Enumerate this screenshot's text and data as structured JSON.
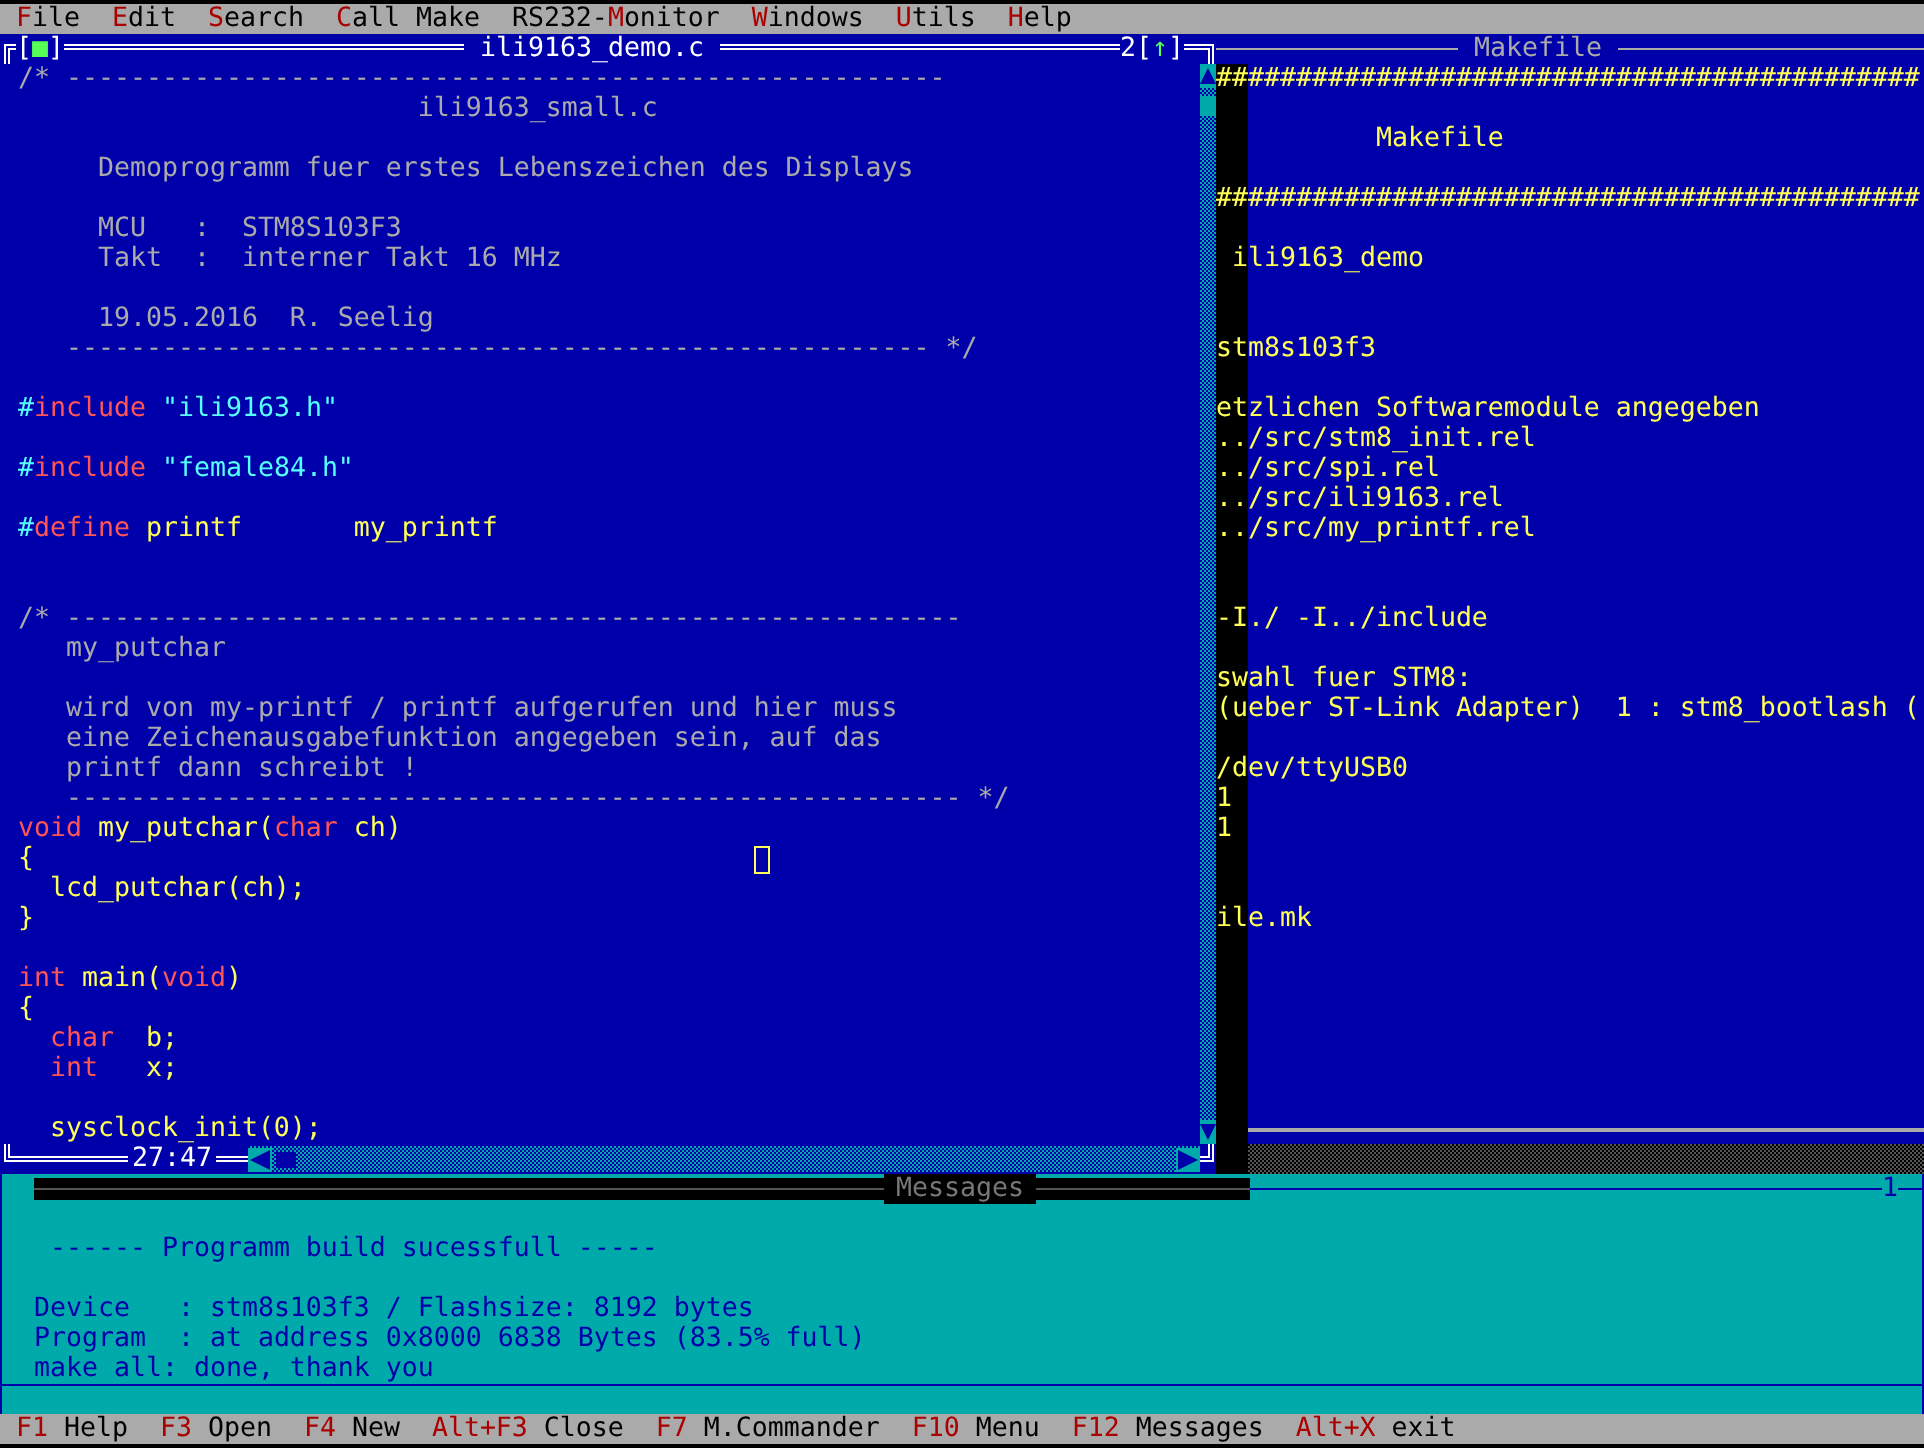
{
  "menu_bar": [
    {
      "key": "F",
      "rest": "ile"
    },
    {
      "key": "E",
      "rest": "dit"
    },
    {
      "key": "S",
      "rest": "earch"
    },
    {
      "key": "C",
      "rest": "all Make"
    },
    {
      "prefix": "RS232-",
      "key": "M",
      "rest": "onitor"
    },
    {
      "key": "W",
      "rest": "indows"
    },
    {
      "key": "U",
      "rest": "tils"
    },
    {
      "key": "H",
      "rest": "elp"
    }
  ],
  "editor": {
    "close_button": {
      "left": "[",
      "mark": "■",
      "right": "]"
    },
    "title": "ili9163_demo.c",
    "window_number": "2",
    "zoom_button": {
      "left": "[",
      "mark": "↑",
      "right": "]"
    },
    "position": "27:47",
    "lines": [
      {
        "kind": "code",
        "tokens": [
          {
            "text": "/* -------------------------------------------------------",
            "kind": "comment"
          }
        ]
      },
      {
        "kind": "code",
        "tokens": [
          {
            "text": "                         ili9163_small.c",
            "kind": "comment"
          }
        ]
      },
      {
        "kind": "blank"
      },
      {
        "kind": "code",
        "tokens": [
          {
            "text": "     Demoprogramm fuer erstes Lebenszeichen des Displays",
            "kind": "comment"
          }
        ]
      },
      {
        "kind": "blank"
      },
      {
        "kind": "code",
        "tokens": [
          {
            "text": "     MCU   :  STM8S103F3",
            "kind": "comment"
          }
        ]
      },
      {
        "kind": "code",
        "tokens": [
          {
            "text": "     Takt  :  interner Takt 16 MHz",
            "kind": "comment"
          }
        ]
      },
      {
        "kind": "blank"
      },
      {
        "kind": "code",
        "tokens": [
          {
            "text": "     19.05.2016  R. Seelig",
            "kind": "comment"
          }
        ]
      },
      {
        "kind": "code",
        "tokens": [
          {
            "text": "   ------------------------------------------------------ */",
            "kind": "comment"
          }
        ]
      },
      {
        "kind": "blank"
      },
      {
        "kind": "code",
        "tokens": [
          {
            "text": "#",
            "kind": "hash"
          },
          {
            "text": "include",
            "kind": "keyword"
          },
          {
            "text": " \"ili9163.h\"",
            "kind": "string"
          }
        ]
      },
      {
        "kind": "blank"
      },
      {
        "kind": "code",
        "tokens": [
          {
            "text": "#",
            "kind": "hash"
          },
          {
            "text": "include",
            "kind": "keyword"
          },
          {
            "text": " \"female84.h\"",
            "kind": "string"
          }
        ]
      },
      {
        "kind": "blank"
      },
      {
        "kind": "code",
        "tokens": [
          {
            "text": "#",
            "kind": "hash"
          },
          {
            "text": "define",
            "kind": "keyword"
          },
          {
            "text": " printf       my_printf",
            "kind": "plain"
          }
        ]
      },
      {
        "kind": "blank"
      },
      {
        "kind": "blank"
      },
      {
        "kind": "code",
        "tokens": [
          {
            "text": "/* --------------------------------------------------------",
            "kind": "comment"
          }
        ]
      },
      {
        "kind": "code",
        "tokens": [
          {
            "text": "   my_putchar",
            "kind": "comment"
          }
        ]
      },
      {
        "kind": "blank"
      },
      {
        "kind": "code",
        "tokens": [
          {
            "text": "   wird von my-printf / printf aufgerufen und hier muss",
            "kind": "comment"
          }
        ]
      },
      {
        "kind": "code",
        "tokens": [
          {
            "text": "   eine Zeichenausgabefunktion angegeben sein, auf das",
            "kind": "comment"
          }
        ]
      },
      {
        "kind": "code",
        "tokens": [
          {
            "text": "   printf dann schreibt !",
            "kind": "comment"
          }
        ]
      },
      {
        "kind": "code",
        "tokens": [
          {
            "text": "   -------------------------------------------------------- */",
            "kind": "comment"
          }
        ]
      },
      {
        "kind": "code",
        "tokens": [
          {
            "text": "void",
            "kind": "keyword"
          },
          {
            "text": " my_putchar(",
            "kind": "plain"
          },
          {
            "text": "char",
            "kind": "keyword"
          },
          {
            "text": " ch)",
            "kind": "plain"
          }
        ]
      },
      {
        "kind": "code",
        "tokens": [
          {
            "text": "{",
            "kind": "plain"
          }
        ]
      },
      {
        "kind": "code",
        "tokens": [
          {
            "text": "  lcd_putchar(ch);",
            "kind": "plain"
          }
        ]
      },
      {
        "kind": "code",
        "tokens": [
          {
            "text": "}",
            "kind": "plain"
          }
        ]
      },
      {
        "kind": "blank"
      },
      {
        "kind": "code",
        "tokens": [
          {
            "text": "int",
            "kind": "keyword"
          },
          {
            "text": " main(",
            "kind": "plain"
          },
          {
            "text": "void",
            "kind": "keyword"
          },
          {
            "text": ")",
            "kind": "plain"
          }
        ]
      },
      {
        "kind": "code",
        "tokens": [
          {
            "text": "{",
            "kind": "plain"
          }
        ]
      },
      {
        "kind": "code",
        "tokens": [
          {
            "text": "  char",
            "kind": "keyword"
          },
          {
            "text": "  b;",
            "kind": "plain"
          }
        ]
      },
      {
        "kind": "code",
        "tokens": [
          {
            "text": "  int",
            "kind": "keyword"
          },
          {
            "text": "   x;",
            "kind": "plain"
          }
        ]
      },
      {
        "kind": "blank"
      },
      {
        "kind": "code",
        "tokens": [
          {
            "text": "  sysclock_init(0);",
            "kind": "plain"
          }
        ]
      }
    ]
  },
  "makefile_window": {
    "title": "Makefile",
    "lines": [
      {
        "kind": "text",
        "text": "############################################"
      },
      {
        "kind": "blank"
      },
      {
        "kind": "text",
        "text": "          Makefile"
      },
      {
        "kind": "blank"
      },
      {
        "kind": "text",
        "text": "############################################"
      },
      {
        "kind": "blank"
      },
      {
        "kind": "text",
        "text": " ili9163_demo"
      },
      {
        "kind": "blank"
      },
      {
        "kind": "blank"
      },
      {
        "kind": "text",
        "text": "stm8s103f3"
      },
      {
        "kind": "blank"
      },
      {
        "kind": "text",
        "text": "etzlichen Softwaremodule angegeben"
      },
      {
        "kind": "text",
        "text": "../src/stm8_init.rel"
      },
      {
        "kind": "text",
        "text": "../src/spi.rel"
      },
      {
        "kind": "text",
        "text": "../src/ili9163.rel"
      },
      {
        "kind": "text",
        "text": "../src/my_printf.rel"
      },
      {
        "kind": "blank"
      },
      {
        "kind": "blank"
      },
      {
        "kind": "text",
        "text": "-I./ -I../include"
      },
      {
        "kind": "blank"
      },
      {
        "kind": "text",
        "text": "swahl fuer STM8:"
      },
      {
        "kind": "text",
        "text": "(ueber ST-Link Adapter)  1 : stm8_bootlash ("
      },
      {
        "kind": "blank"
      },
      {
        "kind": "text",
        "text": "/dev/ttyUSB0"
      },
      {
        "kind": "text",
        "text": "1"
      },
      {
        "kind": "text",
        "text": "1"
      },
      {
        "kind": "blank"
      },
      {
        "kind": "blank"
      },
      {
        "kind": "text",
        "text": "ile.mk"
      },
      {
        "kind": "blank"
      },
      {
        "kind": "blank"
      },
      {
        "kind": "blank"
      },
      {
        "kind": "blank"
      },
      {
        "kind": "blank"
      },
      {
        "kind": "blank"
      }
    ]
  },
  "messages_window": {
    "title": "Messages",
    "window_number": "1",
    "lines": [
      {
        "kind": "blank"
      },
      {
        "kind": "banner",
        "text": "------ Programm build sucessfull -----"
      },
      {
        "kind": "blank"
      },
      {
        "kind": "text",
        "text": "Device   : stm8s103f3 / Flashsize: 8192 bytes"
      },
      {
        "kind": "text",
        "text": "Program  : at address 0x8000 6838 Bytes (83.5% full)"
      },
      {
        "kind": "text",
        "text": "make all: done, thank you"
      }
    ]
  },
  "status_bar": [
    {
      "key": "F1",
      "label": "Help"
    },
    {
      "key": "F3",
      "label": "Open"
    },
    {
      "key": "F4",
      "label": "New"
    },
    {
      "key": "Alt+F3",
      "label": "Close"
    },
    {
      "key": "F7",
      "label": "M.Commander"
    },
    {
      "key": "F10",
      "label": "Menu"
    },
    {
      "key": "F12",
      "label": "Messages"
    },
    {
      "key": "Alt+X",
      "label": "exit"
    }
  ]
}
